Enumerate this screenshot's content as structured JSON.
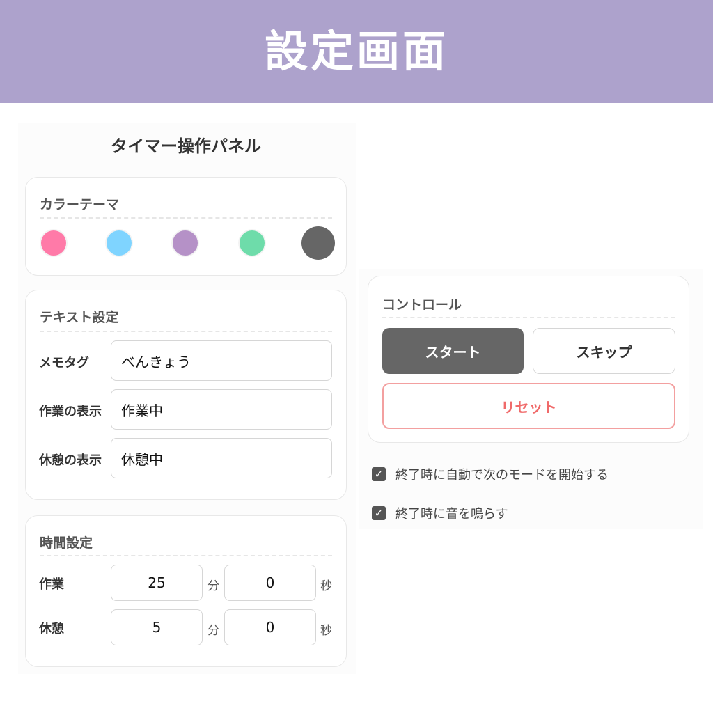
{
  "header": {
    "title": "設定画面"
  },
  "panel": {
    "title": "タイマー操作パネル"
  },
  "color_theme": {
    "heading": "カラーテーマ",
    "swatches": [
      {
        "name": "pink",
        "color": "#ff7aa8"
      },
      {
        "name": "light-blue",
        "color": "#7fd4ff"
      },
      {
        "name": "purple",
        "color": "#b591c7"
      },
      {
        "name": "green",
        "color": "#6edcaa"
      },
      {
        "name": "dark-gray",
        "color": "#666666"
      }
    ]
  },
  "text_settings": {
    "heading": "テキスト設定",
    "rows": [
      {
        "label": "メモタグ",
        "value": "べんきょう"
      },
      {
        "label": "作業の表示",
        "value": "作業中"
      },
      {
        "label": "休憩の表示",
        "value": "休憩中"
      }
    ]
  },
  "time_settings": {
    "heading": "時間設定",
    "minute_unit": "分",
    "second_unit": "秒",
    "rows": [
      {
        "label": "作業",
        "minutes": "25",
        "seconds": "0"
      },
      {
        "label": "休憩",
        "minutes": "5",
        "seconds": "0"
      }
    ]
  },
  "controls": {
    "heading": "コントロール",
    "start_label": "スタート",
    "skip_label": "スキップ",
    "reset_label": "リセット"
  },
  "options": [
    {
      "label": "終了時に自動で次のモードを開始する",
      "checked": true
    },
    {
      "label": "終了時に音を鳴らす",
      "checked": true
    }
  ],
  "colors": {
    "header_bg": "#ada2cc",
    "start_button": "#666666",
    "reset_text": "#f06a6a"
  }
}
